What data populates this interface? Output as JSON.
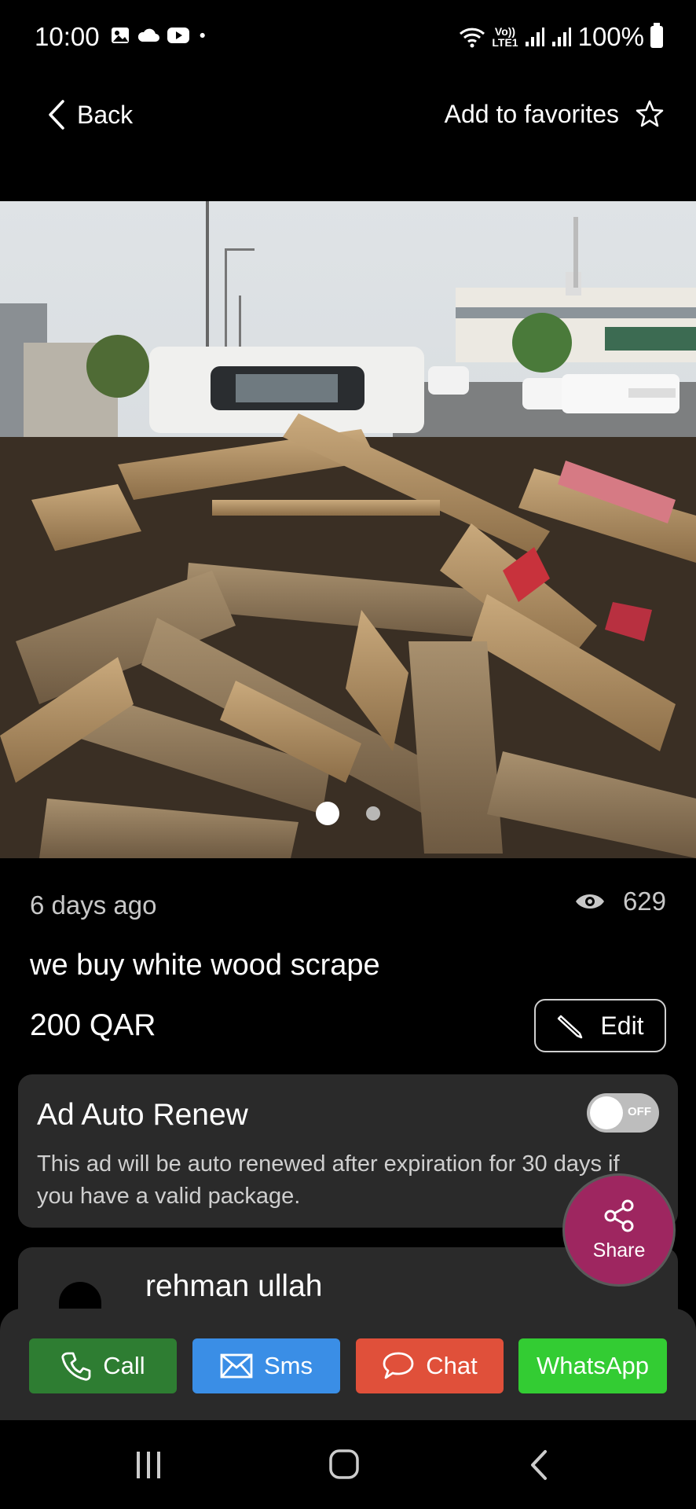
{
  "status_bar": {
    "time": "10:00",
    "battery": "100%",
    "network_label_top": "Vo))",
    "network_label_bottom": "LTE1",
    "icons": [
      "gallery-icon",
      "cloud-icon",
      "youtube-icon",
      "dot-icon",
      "wifi-icon",
      "signal-icon",
      "signal-icon",
      "battery-icon"
    ]
  },
  "top_nav": {
    "back_label": "Back",
    "favorites_label": "Add to favorites"
  },
  "gallery": {
    "image_count": 2,
    "active_index": 0
  },
  "listing": {
    "posted": "6 days ago",
    "views": "629",
    "title": "we buy white wood scrape",
    "price": "200 QAR",
    "edit_label": "Edit"
  },
  "auto_renew": {
    "title": "Ad Auto Renew",
    "description": "This ad will be auto renewed after expiration for 30 days if you have a valid package.",
    "toggle_label": "OFF",
    "enabled": false
  },
  "seller": {
    "name": "rehman ullah"
  },
  "share": {
    "label": "Share",
    "color": "#9e2660"
  },
  "actions": {
    "call": "Call",
    "sms": "Sms",
    "chat": "Chat",
    "whatsapp": "WhatsApp",
    "colors": {
      "call": "#2e7d32",
      "sms": "#3a8ee6",
      "chat": "#e0503a",
      "whatsapp": "#33cc33"
    }
  }
}
